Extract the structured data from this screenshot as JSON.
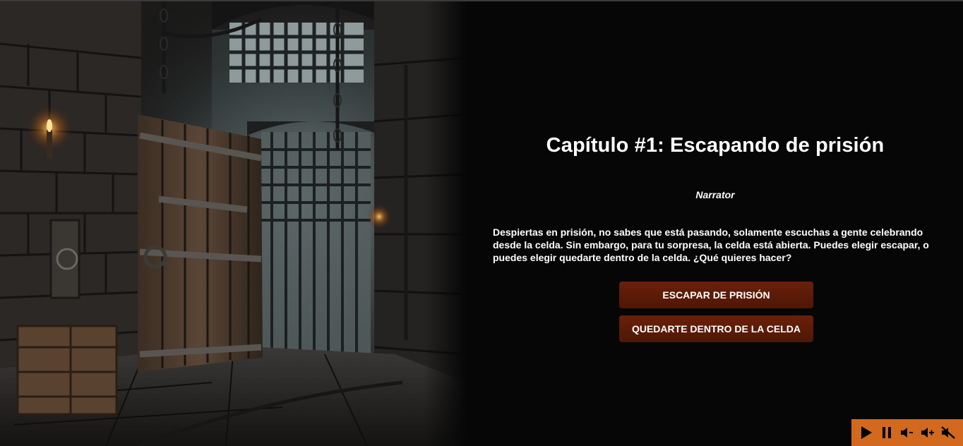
{
  "chapter": {
    "title": "Capítulo #1: Escapando de prisión"
  },
  "dialogue": {
    "speaker": "Narrator",
    "text": "Despiertas en prisión, no sabes que está pasando, solamente escuchas a gente celebrando desde la celda. Sin embargo, para tu sorpresa, la celda está abierta. Puedes elegir escapar, o puedes elegir quedarte dentro de la celda. ¿Qué quieres hacer?"
  },
  "choices": [
    {
      "label": "ESCAPAR DE PRISIÓN"
    },
    {
      "label": "QUEDARTE DENTRO DE LA CELDA"
    }
  ],
  "audio_controls": {
    "background": "#d2691e",
    "icons": [
      "play-icon",
      "pause-icon",
      "volume-down-icon",
      "volume-up-icon",
      "mute-icon"
    ]
  },
  "colors": {
    "background": "#060606",
    "button": "#5a1a08",
    "text": "#ffffff"
  },
  "scene": {
    "description_icon": "prison-cell-illustration"
  }
}
